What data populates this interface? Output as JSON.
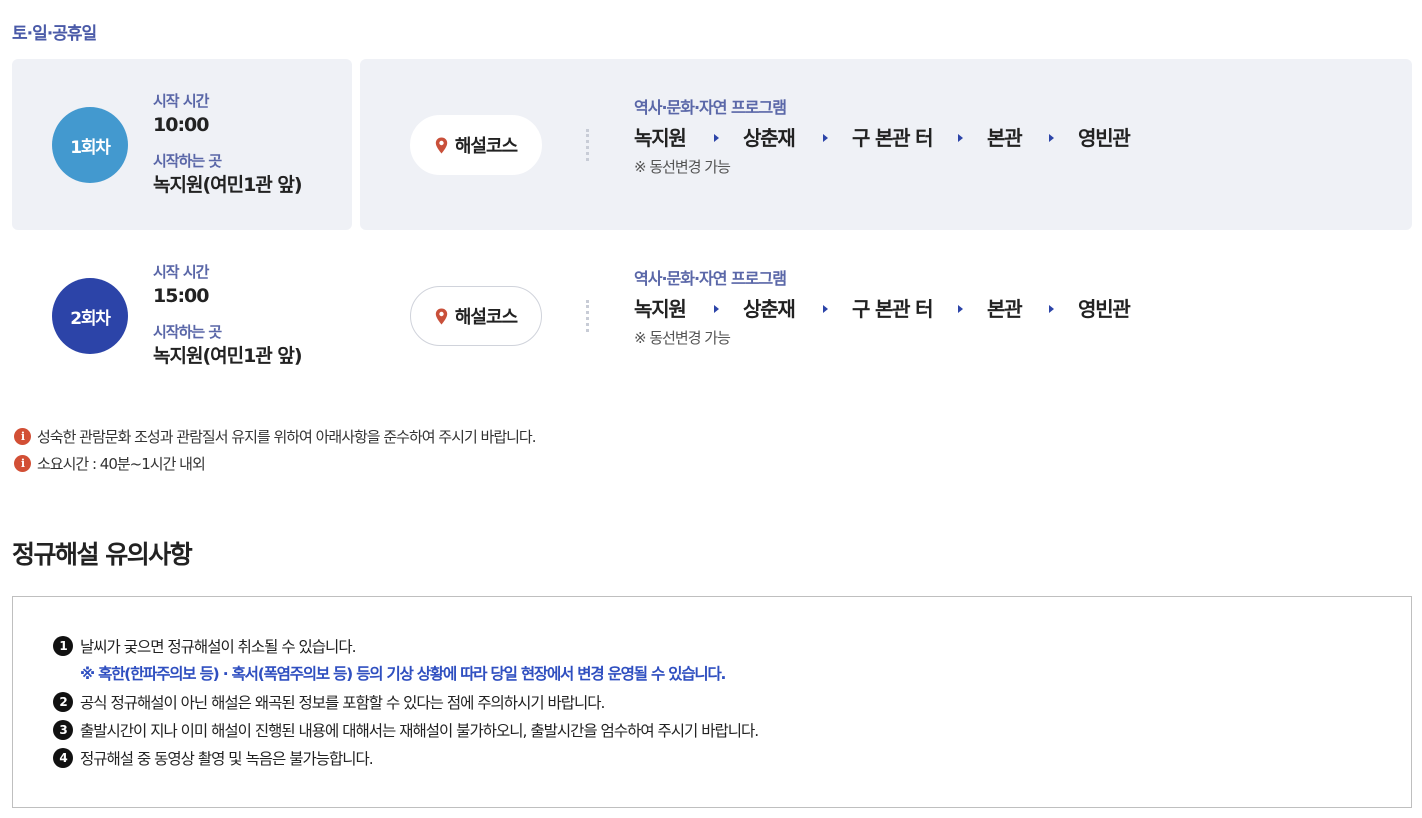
{
  "section_label": "토·일·공휴일",
  "sessions": [
    {
      "badge": "1회차",
      "start_time_label": "시작 시간",
      "start_time": "10:00",
      "start_place_label": "시작하는 곳",
      "start_place": "녹지원(여민1관 앞)",
      "course_label": "해설코스",
      "program_name": "역사·문화·자연 프로그램",
      "route": [
        "녹지원",
        "상춘재",
        "구 본관 터",
        "본관",
        "영빈관"
      ],
      "note": "※ 동선변경 가능"
    },
    {
      "badge": "2회차",
      "start_time_label": "시작 시간",
      "start_time": "15:00",
      "start_place_label": "시작하는 곳",
      "start_place": "녹지원(여민1관 앞)",
      "course_label": "해설코스",
      "program_name": "역사·문화·자연 프로그램",
      "route": [
        "녹지원",
        "상춘재",
        "구 본관 터",
        "본관",
        "영빈관"
      ],
      "note": "※ 동선변경 가능"
    }
  ],
  "info_lines": [
    "성숙한 관람문화 조성과 관람질서 유지를 위하여 아래사항을 준수하여 주시기 바랍니다.",
    "소요시간 : 40분~1시간 내외"
  ],
  "notice": {
    "title": "정규해설 유의사항",
    "items": [
      {
        "num": "1",
        "text": "날씨가 궂으면 정규해설이 취소될 수 있습니다.",
        "sub": "※ 혹한(한파주의보 등) · 혹서(폭염주의보 등) 등의 기상 상황에 따라 당일 현장에서 변경 운영될 수 있습니다."
      },
      {
        "num": "2",
        "text": "공식 정규해설이 아닌 해설은 왜곡된 정보를 포함할 수 있다는 점에 주의하시기 바랍니다."
      },
      {
        "num": "3",
        "text": "출발시간이 지나 이미 해설이 진행된 내용에 대해서는 재해설이 불가하오니, 출발시간을 엄수하여 주시기 바랍니다."
      },
      {
        "num": "4",
        "text": "정규해설 중 동영상 촬영 및 녹음은 불가능합니다."
      }
    ]
  },
  "colors": {
    "badge_1": "#4399cf",
    "badge_2": "#2c44a8",
    "label": "#5a67a8",
    "info_icon": "#d24f35",
    "pin": "#c9503a",
    "notice_sub": "#2f4fc0"
  }
}
